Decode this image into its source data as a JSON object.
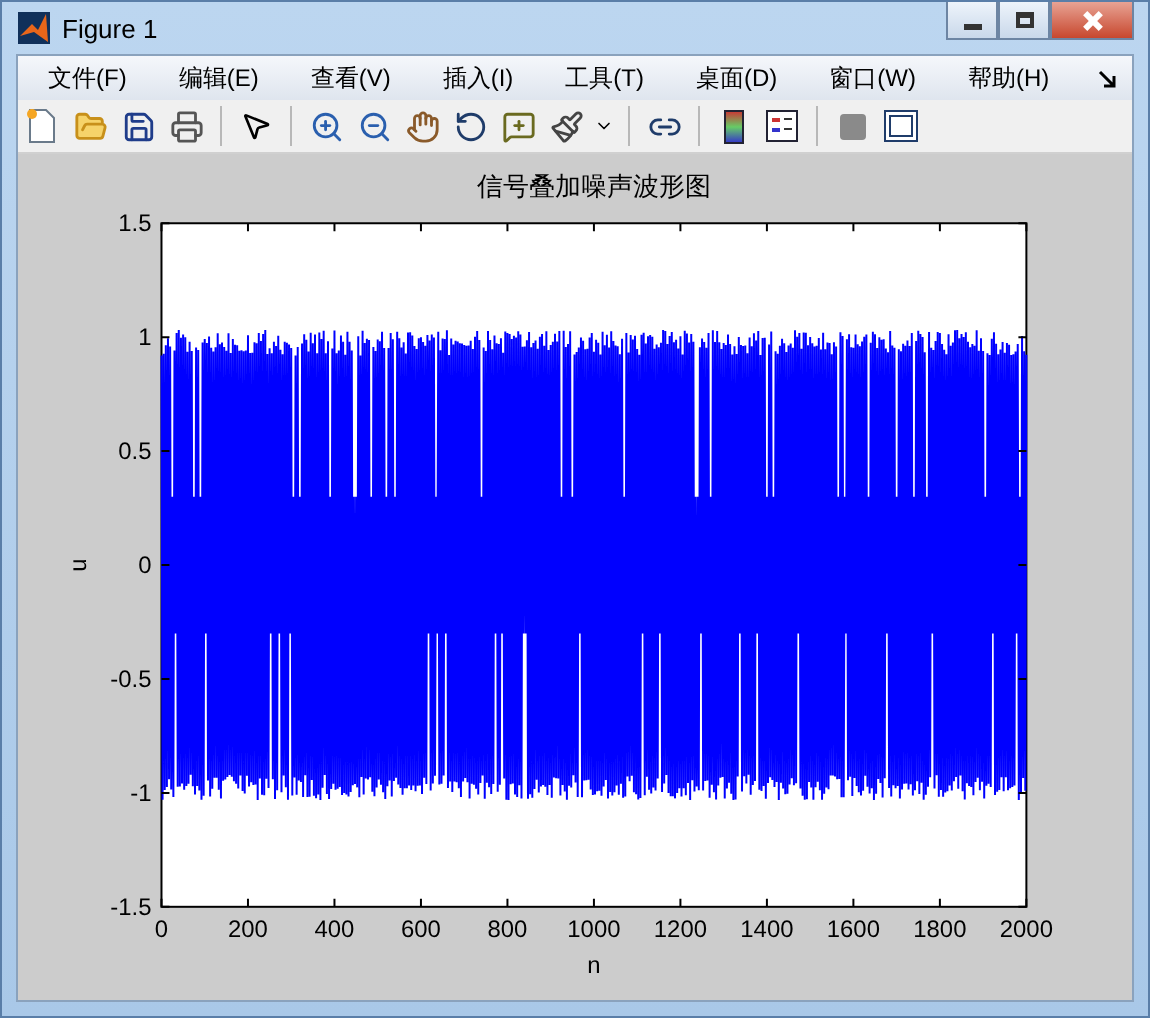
{
  "window": {
    "title": "Figure 1"
  },
  "menu": [
    "文件(F)",
    "编辑(E)",
    "查看(V)",
    "插入(I)",
    "工具(T)",
    "桌面(D)",
    "窗口(W)",
    "帮助(H)"
  ],
  "axes": {
    "title": "信号叠加噪声波形图",
    "xlabel": "n",
    "ylabel": "u",
    "xticks": [
      "0",
      "200",
      "400",
      "600",
      "800",
      "1000",
      "1200",
      "1400",
      "1600",
      "1800",
      "2000"
    ],
    "yticks": [
      "1.5",
      "1",
      "0.5",
      "0",
      "-0.5",
      "-1",
      "-1.5"
    ]
  }
}
